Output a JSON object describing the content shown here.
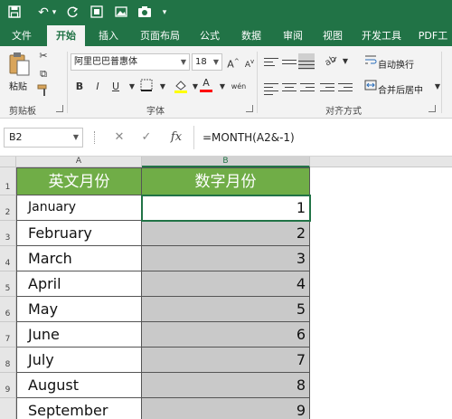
{
  "quick_access": {
    "icons": [
      "save-icon",
      "undo-icon",
      "redo-icon",
      "screenshot-icon",
      "picture-icon",
      "camera-icon",
      "customize-icon"
    ],
    "undo_glyph": "↶",
    "dropdown_glyph": "▾"
  },
  "tabs": [
    {
      "label": "文件",
      "active": false
    },
    {
      "label": "开始",
      "active": true
    },
    {
      "label": "插入",
      "active": false
    },
    {
      "label": "页面布局",
      "active": false
    },
    {
      "label": "公式",
      "active": false
    },
    {
      "label": "数据",
      "active": false
    },
    {
      "label": "审阅",
      "active": false
    },
    {
      "label": "视图",
      "active": false
    },
    {
      "label": "开发工具",
      "active": false
    },
    {
      "label": "PDF工",
      "active": false
    }
  ],
  "ribbon": {
    "clipboard": {
      "paste_label": "粘贴",
      "group_label": "剪贴板"
    },
    "font": {
      "font_name": "阿里巴巴普惠体",
      "font_size": "18",
      "grow": "A",
      "shrink": "A",
      "bold": "B",
      "italic": "I",
      "underline": "U",
      "font_color_glyph": "A",
      "phonetic": "wén",
      "group_label": "字体"
    },
    "alignment": {
      "wrap_text": "自动换行",
      "merge_center": "合并后居中",
      "group_label": "对齐方式"
    }
  },
  "formula_bar": {
    "name_box": "B2",
    "cancel": "✕",
    "enter": "✓",
    "fx": "fx",
    "formula": "=MONTH(A2&-1)"
  },
  "sheet": {
    "col_headers": [
      "A",
      "B"
    ],
    "row_headers": [
      "1",
      "2",
      "3",
      "4",
      "5",
      "6",
      "7",
      "8",
      "9"
    ],
    "header_row": [
      "英文月份",
      "数字月份"
    ],
    "rows": [
      {
        "a": "January",
        "b": "1"
      },
      {
        "a": "February",
        "b": "2"
      },
      {
        "a": "March",
        "b": "3"
      },
      {
        "a": "April",
        "b": "4"
      },
      {
        "a": "May",
        "b": "5"
      },
      {
        "a": "June",
        "b": "6"
      },
      {
        "a": "July",
        "b": "7"
      },
      {
        "a": "August",
        "b": "8"
      },
      {
        "a": "September",
        "b": "9"
      }
    ],
    "colors": {
      "header_fill": "#70ad47",
      "selection_fill": "#c9c9c9",
      "accent": "#217346"
    }
  }
}
